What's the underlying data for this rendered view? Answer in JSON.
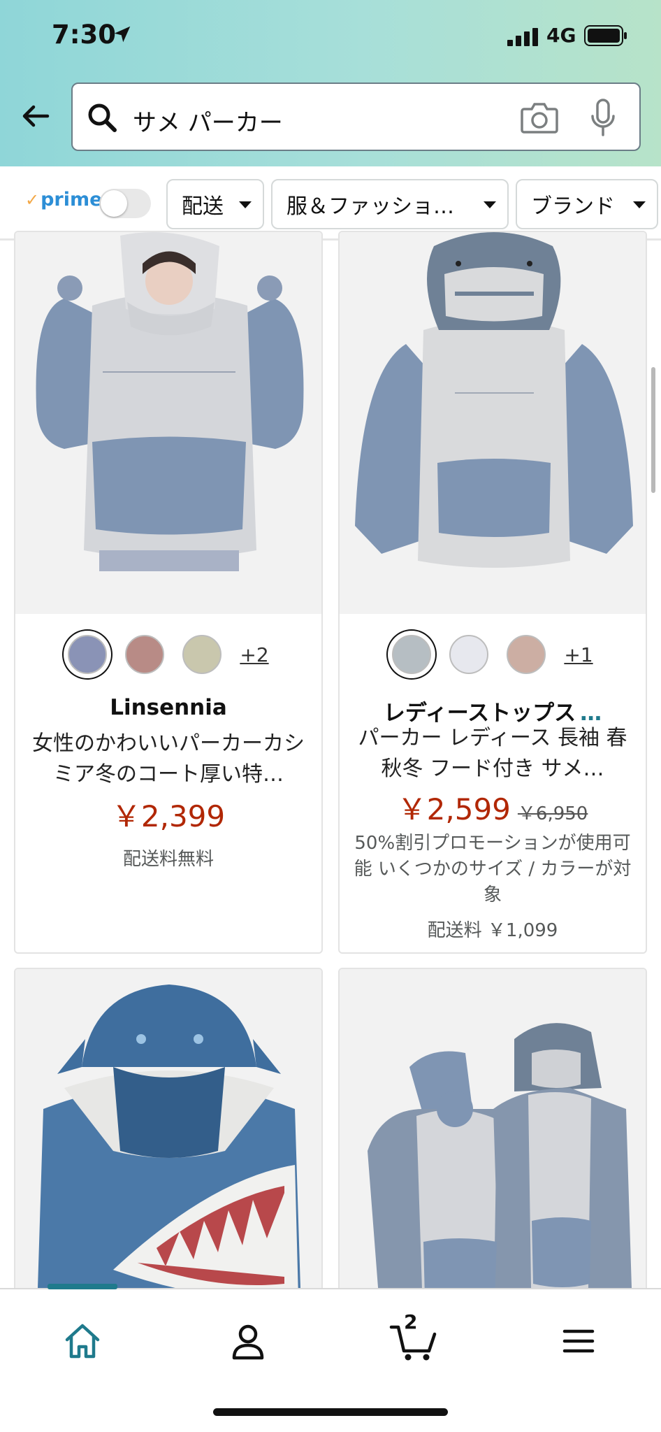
{
  "status_bar": {
    "time": "7:30",
    "network": "4G"
  },
  "search": {
    "query": "サメ パーカー"
  },
  "filters": {
    "prime_label": "prime",
    "prime_check": "✓",
    "chips": [
      {
        "label": "配送"
      },
      {
        "label": "服＆ファッショ…"
      },
      {
        "label": "ブランド"
      }
    ]
  },
  "products": [
    {
      "brand": "Linsennia",
      "title": "女性のかわいいパーカーカシミア冬のコート厚い特…",
      "price": "￥2,399",
      "shipping": "配送料無料",
      "swatch_colors": [
        "#8a93b6",
        "#b88b86",
        "#c9c7ad"
      ],
      "swatch_more": "+2"
    },
    {
      "brand": "レディーストップス",
      "brand_more": "…",
      "title": "パーカー レディース 長袖 春秋冬 フード付き サメ…",
      "price": "￥2,599",
      "list_price": "￥6,950",
      "promo": "50%割引プロモーションが使用可能 いくつかのサイズ / カラーが対象",
      "shipping": "配送料 ￥1,099",
      "swatch_colors": [
        "#b6bec3",
        "#e7e8ee",
        "#ccaea3"
      ],
      "swatch_more": "+1"
    }
  ],
  "tabbar": {
    "cart_count": "2"
  },
  "colors": {
    "accent": "#1f7a8c",
    "price": "#b12704",
    "prime_blue": "#2c8ed6"
  }
}
